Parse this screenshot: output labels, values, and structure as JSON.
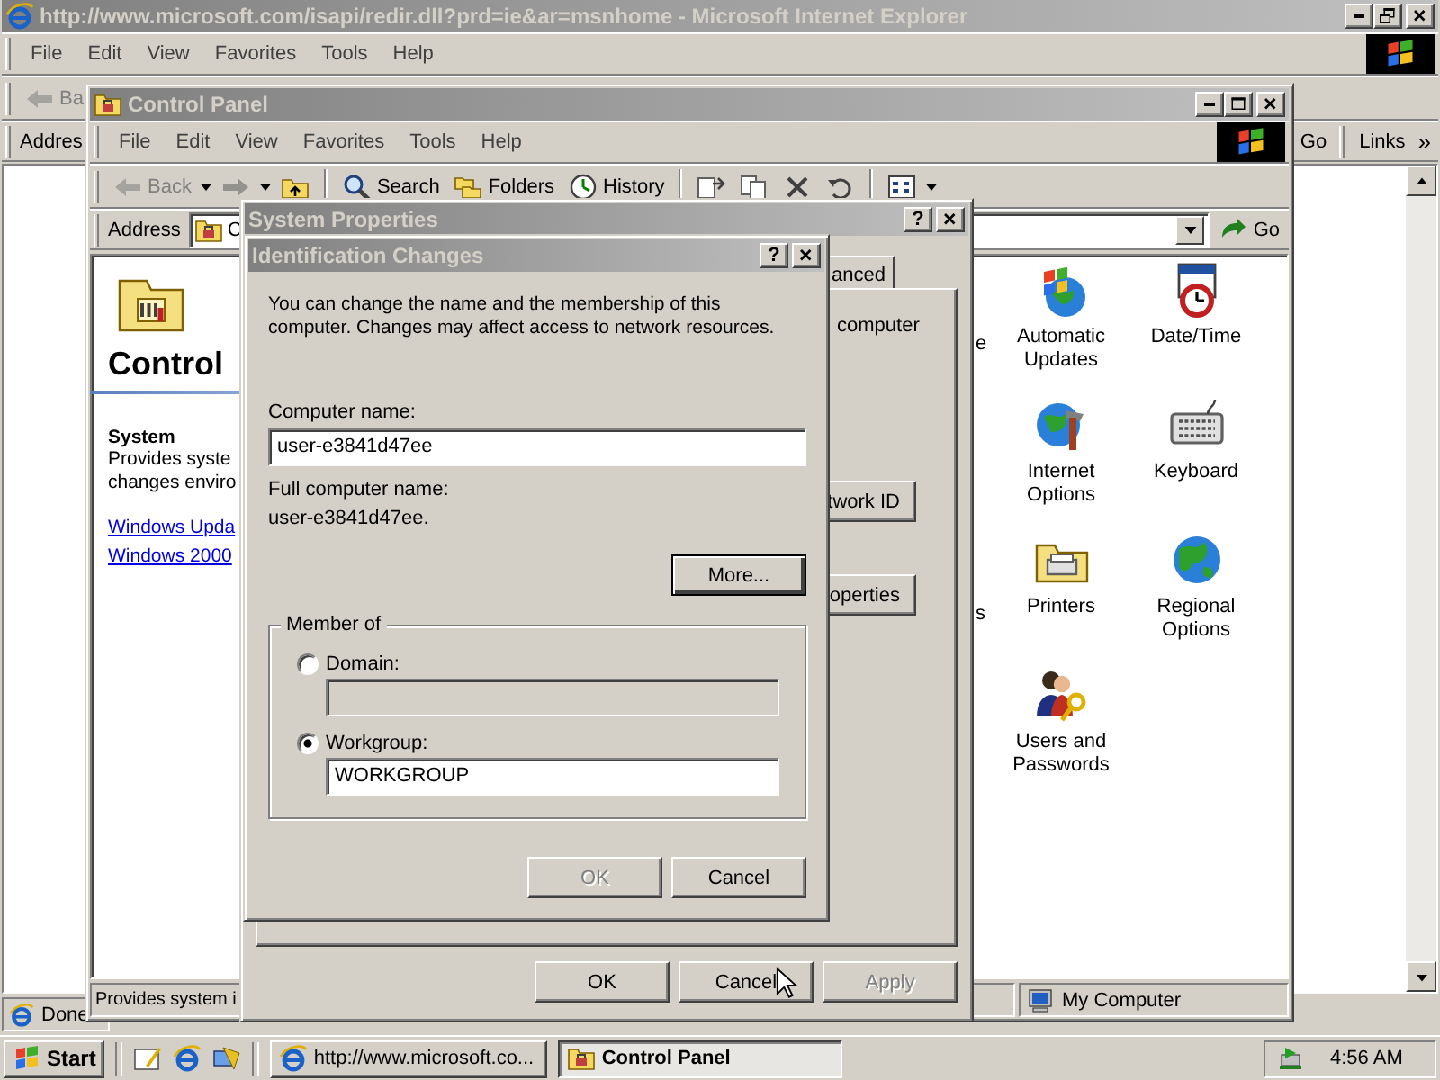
{
  "ie_window": {
    "title": "http://www.microsoft.com/isapi/redir.dll?prd=ie&ar=msnhome - Microsoft Internet Explorer",
    "menu": [
      "File",
      "Edit",
      "View",
      "Favorites",
      "Tools",
      "Help"
    ],
    "back_label": "Ba",
    "address_label": "Addres",
    "go_label": "Go",
    "links_label": "Links",
    "links_more": "»",
    "status": "Done"
  },
  "control_panel": {
    "title": "Control Panel",
    "menu": [
      "File",
      "Edit",
      "View",
      "Favorites",
      "Tools",
      "Help"
    ],
    "toolbar": [
      {
        "kind": "back",
        "label": "Back",
        "disabled": true
      },
      {
        "kind": "forward",
        "disabled": true
      },
      {
        "kind": "up",
        "disabled": false
      },
      {
        "kind": "search",
        "label": "Search",
        "disabled": false
      },
      {
        "kind": "folders",
        "label": "Folders",
        "disabled": false
      },
      {
        "kind": "history",
        "label": "History",
        "disabled": false
      },
      {
        "kind": "move",
        "disabled": false
      },
      {
        "kind": "copy",
        "disabled": false
      },
      {
        "kind": "delete",
        "disabled": false
      },
      {
        "kind": "undo",
        "disabled": false
      },
      {
        "kind": "views",
        "disabled": false
      }
    ],
    "address_label": "Address",
    "address_value": "C",
    "go_label": "Go",
    "heading": "Control",
    "item_title": "System",
    "description_lines": [
      "Provides syste",
      "changes enviro"
    ],
    "links": [
      "Windows Upda",
      "Windows 2000"
    ],
    "items": [
      {
        "kind": "partial",
        "label": "e"
      },
      {
        "kind": "updates",
        "label": "Automatic Updates"
      },
      {
        "kind": "datetime",
        "label": "Date/Time"
      },
      {
        "kind": "internet",
        "label": "Internet Options"
      },
      {
        "kind": "keyboard",
        "label": "Keyboard"
      },
      {
        "kind": "partial",
        "label": "s"
      },
      {
        "kind": "printers",
        "label": "Printers"
      },
      {
        "kind": "regional",
        "label": "Regional Options"
      },
      {
        "kind": "users",
        "label": "Users and Passwords"
      }
    ],
    "status_text": "Provides system i",
    "status_zone": "My Computer"
  },
  "system_properties": {
    "title": "System Properties",
    "help": "?",
    "tabs": [
      {
        "label": "anced",
        "selected": false
      }
    ],
    "text": "computer",
    "panel_buttons": [
      "twork ID",
      "operties"
    ],
    "buttons": [
      {
        "label": "OK",
        "disabled": false
      },
      {
        "label": "Cancel",
        "disabled": false
      },
      {
        "label": "Apply",
        "disabled": true
      }
    ]
  },
  "identification_changes": {
    "title": "Identification Changes",
    "help": "?",
    "intro": "You can change the name and the membership of this computer. Changes may affect access to network resources.",
    "computer_name_label": "Computer name:",
    "computer_name": "user-e3841d47ee",
    "full_name_label": "Full computer name:",
    "full_name": "user-e3841d47ee.",
    "more_button": {
      "label": "More...",
      "default": true
    },
    "member_of": {
      "legend": "Member of",
      "options": [
        {
          "label": "Domain:",
          "selected": false,
          "field_disabled": true
        },
        {
          "label": "Workgroup:",
          "selected": true,
          "field_disabled": false,
          "value": "WORKGROUP"
        }
      ]
    },
    "buttons": [
      {
        "label": "OK",
        "disabled": true
      },
      {
        "label": "Cancel",
        "disabled": false
      }
    ]
  },
  "taskbar": {
    "start": "Start",
    "tasks": [
      {
        "kind": "browser",
        "label": "http://www.microsoft.co...",
        "selected": false
      },
      {
        "kind": "folder",
        "label": "Control Panel",
        "selected": true
      }
    ],
    "clock": "4:56 AM"
  }
}
